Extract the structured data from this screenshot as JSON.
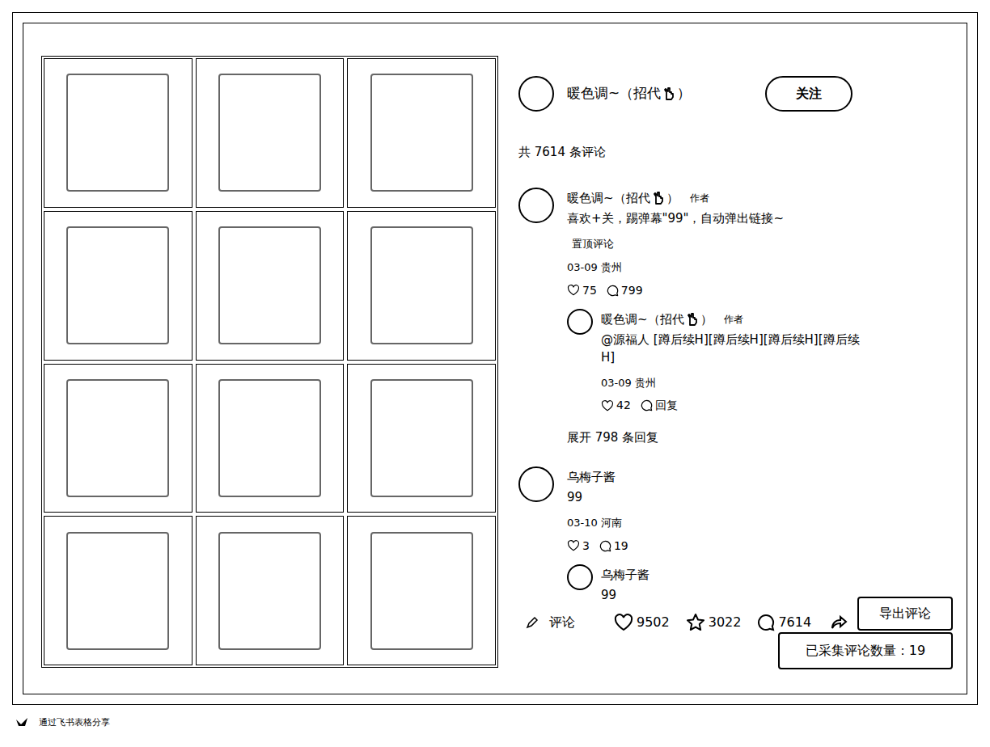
{
  "post": {
    "author": {
      "name": "暖色调~（招代",
      "name_end": "）"
    },
    "follow_button": "关注"
  },
  "comments_header": "共 7614 条评论",
  "comments": [
    {
      "name": "暖色调~（招代",
      "name_end": "）",
      "author_tag": "作者",
      "text": "喜欢+关，踢弹幕\"99\"，自动弹出链接~",
      "pinned_label": "置顶评论",
      "date": "03-09 贵州",
      "likes": "75",
      "replies": "799",
      "reply_list": [
        {
          "name": "暖色调~（招代",
          "name_end": "）",
          "author_tag": "作者",
          "text": "@源福人 [蹲后续H][蹲后续H][蹲后续H][蹲后续H]",
          "date": "03-09 贵州",
          "likes": "42",
          "reply_label": "回复"
        }
      ],
      "expand": "展开 798 条回复"
    },
    {
      "name": "乌梅子酱",
      "text": "99",
      "date": "03-10 河南",
      "likes": "3",
      "replies": "19",
      "reply_list": [
        {
          "name": "乌梅子酱",
          "text": "99"
        }
      ]
    }
  ],
  "bottom_bar": {
    "comment_placeholder": "评论",
    "likes": "9502",
    "stars": "3022",
    "comments": "7614"
  },
  "overlay": {
    "export_button": "导出评论",
    "collected": "已采集评论数量：19"
  },
  "footer": "通过飞书表格分享"
}
